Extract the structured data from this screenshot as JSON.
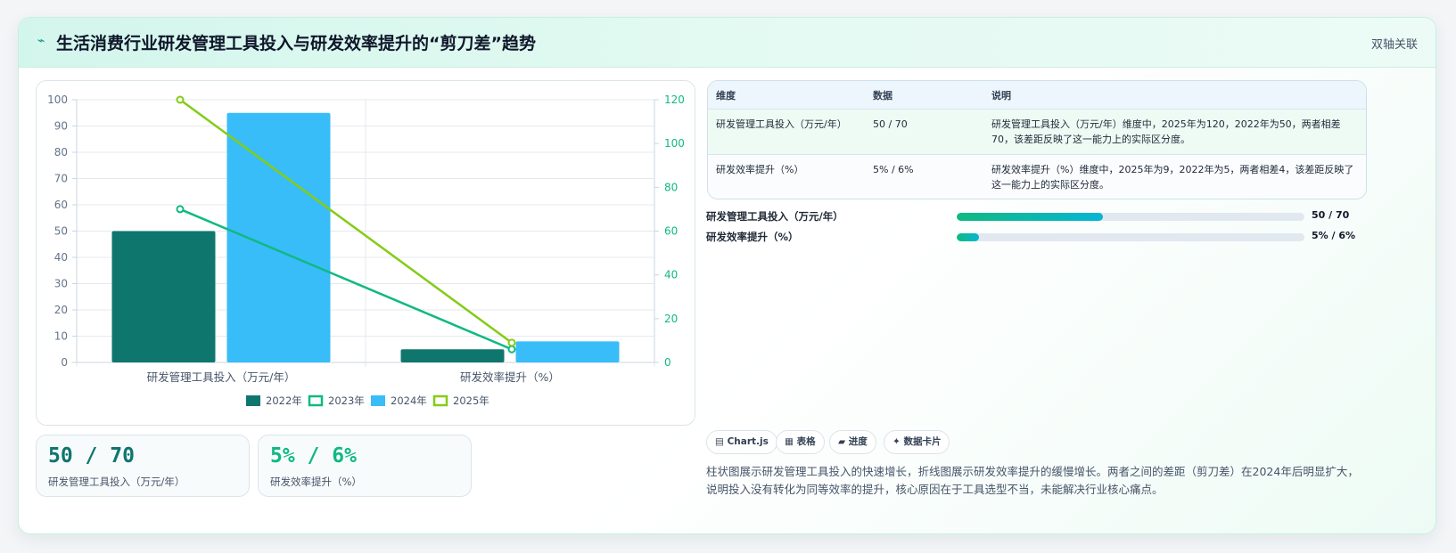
{
  "header": {
    "icon": "bolt-icon",
    "title": "生活消费行业研发管理工具投入与研发效率提升的“剪刀差”趋势",
    "tag": "双轴关联"
  },
  "colors": {
    "s2022": "#0f766e",
    "s2023": "#10b981",
    "s2024": "#38bdf8",
    "s2025": "#84cc16"
  },
  "chart_data": {
    "type": "bar",
    "categories": [
      "研发管理工具投入（万元/年）",
      "研发效率提升（%）"
    ],
    "series": [
      {
        "name": "2022年",
        "type": "bar",
        "axis": "left",
        "values": [
          50,
          5
        ]
      },
      {
        "name": "2023年",
        "type": "line",
        "axis": "right",
        "values": [
          70,
          6
        ]
      },
      {
        "name": "2024年",
        "type": "bar",
        "axis": "left",
        "values": [
          95,
          8
        ]
      },
      {
        "name": "2025年",
        "type": "line",
        "axis": "right",
        "values": [
          120,
          9
        ]
      }
    ],
    "yleft": {
      "min": 0,
      "max": 100,
      "ticks": [
        "0",
        "10",
        "20",
        "30",
        "40",
        "50",
        "60",
        "70",
        "80",
        "90",
        "100"
      ]
    },
    "yright": {
      "min": 0,
      "max": 120,
      "ticks": [
        "0",
        "20",
        "40",
        "60",
        "80",
        "100",
        "120"
      ]
    },
    "legend": "bottom",
    "grid": true
  },
  "stats": [
    {
      "value": "50 / 70",
      "label": "研发管理工具投入（万元/年）",
      "color": "#0f766e"
    },
    {
      "value": "5% / 6%",
      "label": "研发效率提升（%）",
      "color": "#10b981"
    }
  ],
  "table": {
    "headers": [
      "维度",
      "数据",
      "说明"
    ],
    "rows": [
      {
        "dim": "研发管理工具投入（万元/年）",
        "data": "50 / 70",
        "desc": "研发管理工具投入（万元/年）维度中，2025年为120，2022年为50，两者相差70，该差距反映了这一能力上的实际区分度。"
      },
      {
        "dim": "研发效率提升（%）",
        "data": "5% / 6%",
        "desc": "研发效率提升（%）维度中，2025年为9，2022年为5，两者相差4，该差距反映了这一能力上的实际区分度。"
      }
    ]
  },
  "progress": [
    {
      "label": "研发管理工具投入（万元/年）",
      "value": "50 / 70",
      "fraction": 0.42
    },
    {
      "label": "研发效率提升（%）",
      "value": "5% / 6%",
      "fraction": 0.065
    }
  ],
  "chips": [
    "▤ Chart.js",
    "▦ 表格",
    "▰ 进度",
    "✦ 数据卡片"
  ],
  "note": "柱状图展示研发管理工具投入的快速增长，折线图展示研发效率提升的缓慢增长。两者之间的差距（剪刀差）在2024年后明显扩大，说明投入没有转化为同等效率的提升，核心原因在于工具选型不当，未能解决行业核心痛点。"
}
